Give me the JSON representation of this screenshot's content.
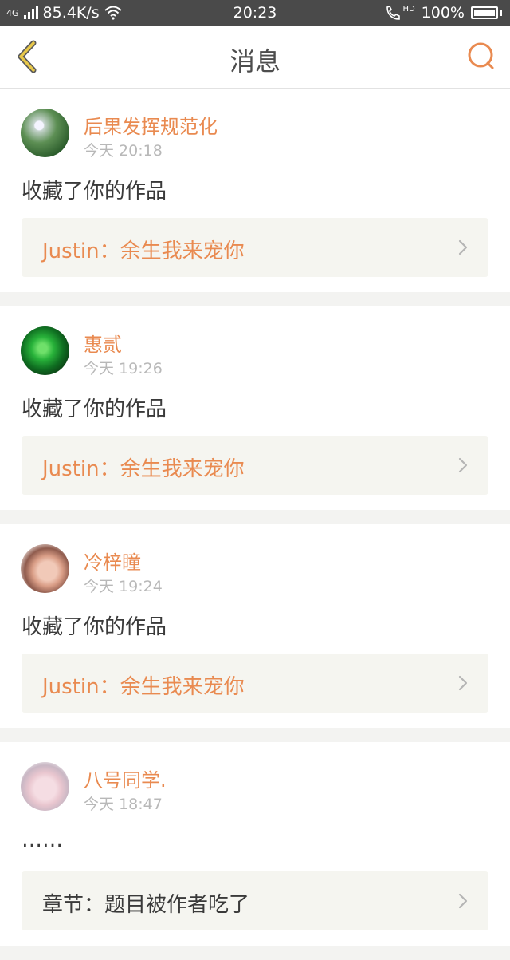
{
  "status_bar": {
    "network": "4G",
    "speed": "85.4K/s",
    "time": "20:23",
    "call_badge": "HD",
    "battery": "100%"
  },
  "header": {
    "title": "消息",
    "back_icon": "chevron-left-icon",
    "search_icon": "search-icon"
  },
  "colors": {
    "accent": "#e98a50",
    "back_icon": "#e8c84a",
    "background": "#f3f3f1",
    "card": "#ffffff",
    "link_box": "#f5f5f0"
  },
  "notifications": [
    {
      "user": "后果发挥规范化",
      "time": "今天 20:18",
      "action": "收藏了你的作品",
      "work": "Justin：余生我来宠你"
    },
    {
      "user": "惠贰",
      "time": "今天 19:26",
      "action": "收藏了你的作品",
      "work": "Justin：余生我来宠你"
    },
    {
      "user": "冷梓瞳",
      "time": "今天 19:24",
      "action": "收藏了你的作品",
      "work": "Justin：余生我来宠你"
    },
    {
      "user": "八号同学.",
      "time": "今天 18:47",
      "action": "……",
      "work": "章节：题目被作者吃了"
    }
  ]
}
